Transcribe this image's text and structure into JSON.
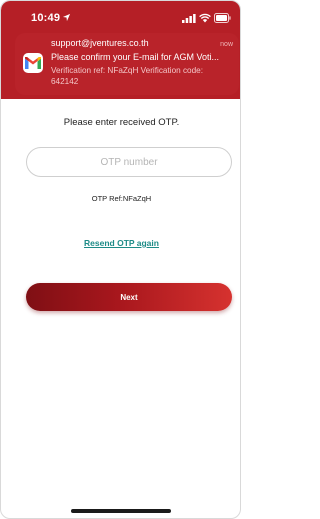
{
  "status_bar": {
    "time": "10:49",
    "icons": [
      "location-arrow-icon",
      "cellular-signal-icon",
      "wifi-icon",
      "battery-icon"
    ]
  },
  "notification": {
    "app_icon": "gmail-icon",
    "sender": "support@jventures.co.th",
    "time": "now",
    "subject": "Please confirm your E-mail for AGM Voti...",
    "preview": "Verification ref: NFaZqH Verification code: 642142"
  },
  "otp_page": {
    "instruction": "Please enter received OTP.",
    "input_placeholder": "OTP number",
    "input_value": "",
    "otp_ref": "OTP Ref:NFaZqH",
    "resend_label": "Resend OTP again",
    "next_label": "Next"
  },
  "colors": {
    "brand_red": "#b51f26",
    "button_gradient_start": "#7f0f14",
    "button_gradient_end": "#d6322f",
    "link_teal": "#1d8b87"
  }
}
